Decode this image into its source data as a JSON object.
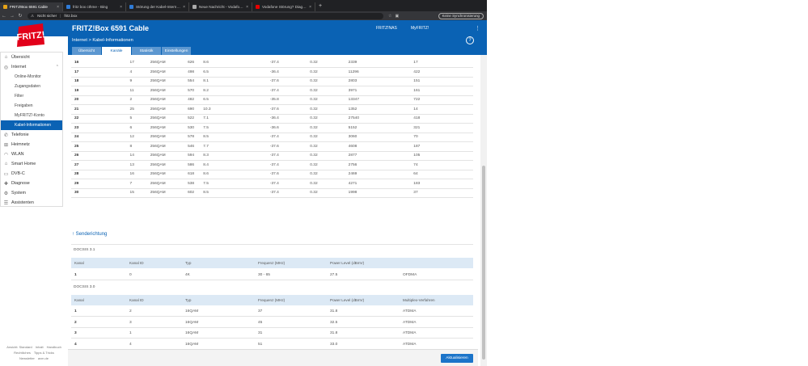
{
  "browser": {
    "tabs": [
      {
        "label": "FRITZ!Box 6591 Cable",
        "active": true,
        "favcolor": "#e6a317"
      },
      {
        "label": "fritz box cthme - Bing",
        "active": false,
        "favcolor": "#2f7bd6"
      },
      {
        "label": "Störung der Kabel-Internet-Diens",
        "active": false,
        "favcolor": "#2f7bd6"
      },
      {
        "label": "Neue Nachricht - Vodafone Comm",
        "active": false,
        "favcolor": "#aaaaaa"
      },
      {
        "label": "Vodafone Störung? Diagnose und",
        "active": false,
        "favcolor": "#e60000"
      }
    ],
    "new_tab": "+",
    "security": "Nicht sicher",
    "url": "fritz.box",
    "sync_label": "Keine Synchronisierung"
  },
  "header": {
    "title": "FRITZ!Box 6591 Cable",
    "link1": "FRITZ!NAS",
    "link2": "MyFRITZ!",
    "menu": "⋮",
    "breadcrumb": "Internet > Kabel-Informationen",
    "help": "?"
  },
  "tabs": [
    "Übersicht",
    "Kanäle",
    "Statistik",
    "Einstellungen"
  ],
  "sidebar": {
    "overview": "Übersicht",
    "internet": "Internet",
    "sub": [
      "Online-Monitor",
      "Zugangsdaten",
      "Filter",
      "Freigaben",
      "MyFRITZ!-Konto",
      "Kabel-Informationen"
    ],
    "items": [
      "Telefonie",
      "Heimnetz",
      "WLAN",
      "Smart Home",
      "DVB-C",
      "Diagnose",
      "System",
      "Assistenten"
    ]
  },
  "footer": {
    "line1": [
      "Ansicht: Standard",
      "Inhalt",
      "Handbuch"
    ],
    "line2": [
      "Rechtliches",
      "Tipps & Tricks"
    ],
    "line3": [
      "Newsletter",
      "avm.de"
    ]
  },
  "downstream_rows": [
    [
      "16",
      "17",
      "256QAM",
      "626",
      "8.6",
      "-37.4",
      "0.32",
      "2339",
      "17"
    ],
    [
      "17",
      "4",
      "256QAM",
      "498",
      "6.5",
      "-36.4",
      "0.32",
      "11296",
      "422"
    ],
    [
      "18",
      "9",
      "256QAM",
      "554",
      "8.1",
      "-37.6",
      "0.32",
      "2803",
      "151"
    ],
    [
      "19",
      "11",
      "256QAM",
      "570",
      "8.2",
      "-37.4",
      "0.32",
      "3971",
      "161"
    ],
    [
      "20",
      "2",
      "256QAM",
      "482",
      "6.5",
      "-35.8",
      "0.32",
      "13347",
      "722"
    ],
    [
      "21",
      "25",
      "256QAM",
      "690",
      "10.3",
      "-37.6",
      "0.32",
      "1352",
      "14"
    ],
    [
      "22",
      "5",
      "256QAM",
      "522",
      "7.1",
      "-36.4",
      "0.32",
      "27540",
      "418"
    ],
    [
      "23",
      "6",
      "256QAM",
      "530",
      "7.5",
      "-36.6",
      "0.32",
      "5152",
      "321"
    ],
    [
      "24",
      "12",
      "256QAM",
      "578",
      "8.5",
      "-37.4",
      "0.32",
      "3060",
      "70"
    ],
    [
      "25",
      "8",
      "256QAM",
      "546",
      "7.7",
      "-37.6",
      "0.32",
      "4608",
      "187"
    ],
    [
      "26",
      "14",
      "256QAM",
      "594",
      "8.3",
      "-37.4",
      "0.32",
      "2877",
      "105"
    ],
    [
      "27",
      "13",
      "256QAM",
      "586",
      "8.4",
      "-37.4",
      "0.32",
      "2756",
      "74"
    ],
    [
      "28",
      "16",
      "256QAM",
      "618",
      "8.6",
      "-37.6",
      "0.32",
      "2469",
      "64"
    ],
    [
      "29",
      "7",
      "256QAM",
      "538",
      "7.5",
      "-37.4",
      "0.32",
      "4271",
      "183"
    ],
    [
      "30",
      "15",
      "256QAM",
      "602",
      "8.5",
      "-37.4",
      "0.32",
      "1998",
      "37"
    ]
  ],
  "upstream": {
    "title": "↑ Senderichtung",
    "docsis31": {
      "label": "DOCSIS 3.1",
      "headers": [
        "Kanal",
        "Kanal ID",
        "Typ",
        "Frequenz (MHz)",
        "Power Level (dBmV)",
        ""
      ],
      "rows": [
        [
          "1",
          "0",
          "4K",
          "30 - 65",
          "27.5",
          "OFDMA"
        ]
      ]
    },
    "docsis30": {
      "label": "DOCSIS 3.0",
      "headers": [
        "Kanal",
        "Kanal ID",
        "Typ",
        "Frequenz (MHz)",
        "Power Level (dBmV)",
        "Multiplex-Verfahren"
      ],
      "rows": [
        [
          "1",
          "2",
          "16QAM",
          "37",
          "31.8",
          "ATDMA"
        ],
        [
          "2",
          "3",
          "16QAM",
          "45",
          "32.5",
          "ATDMA"
        ],
        [
          "3",
          "1",
          "16QAM",
          "31",
          "31.8",
          "ATDMA"
        ],
        [
          "4",
          "4",
          "16QAM",
          "51",
          "33.0",
          "ATDMA"
        ]
      ]
    }
  },
  "refresh_label": "Aktualisieren",
  "colors": {
    "brand": "#0a62b4",
    "header_row": "#dce9f5",
    "tab_bar": "#202124"
  }
}
